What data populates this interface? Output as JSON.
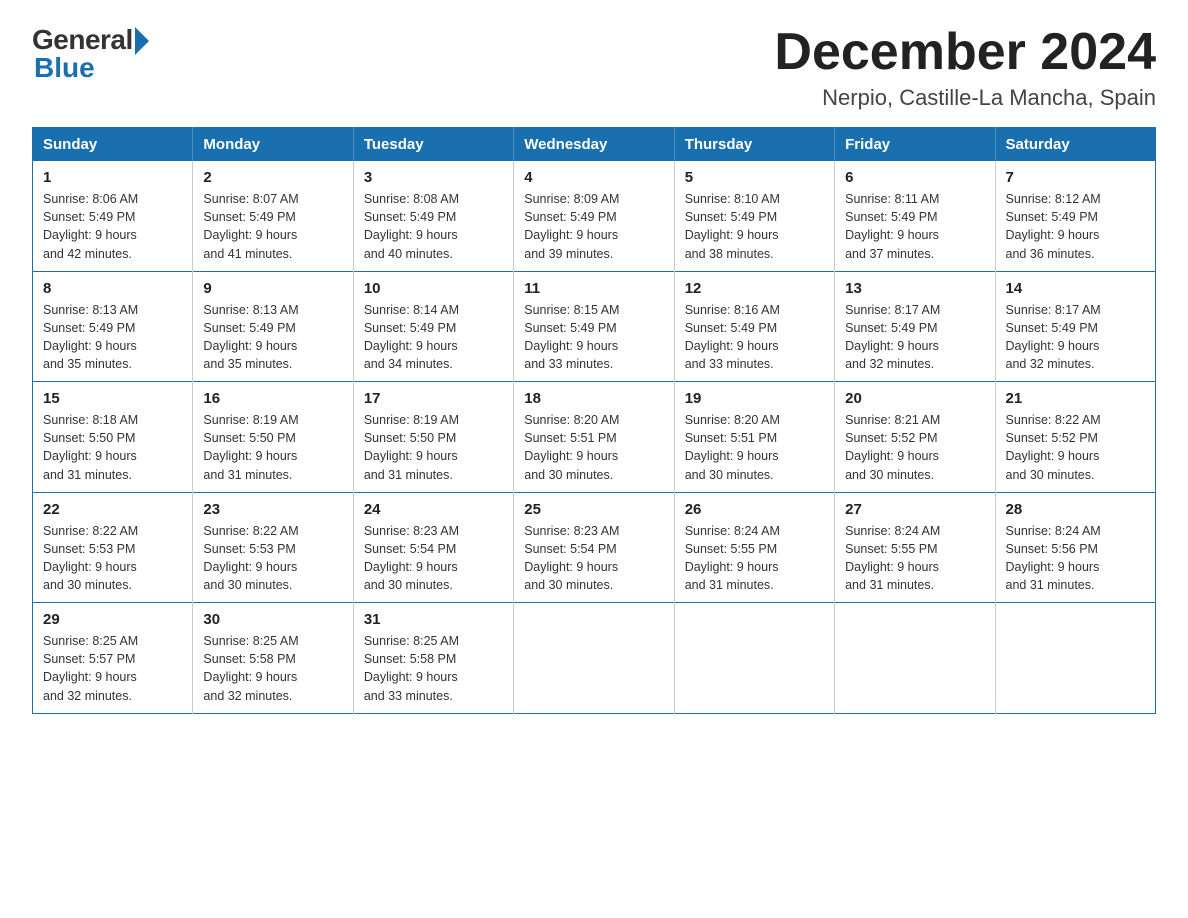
{
  "logo": {
    "general": "General",
    "blue": "Blue"
  },
  "title": "December 2024",
  "location": "Nerpio, Castille-La Mancha, Spain",
  "days_of_week": [
    "Sunday",
    "Monday",
    "Tuesday",
    "Wednesday",
    "Thursday",
    "Friday",
    "Saturday"
  ],
  "weeks": [
    [
      {
        "day": "1",
        "sunrise": "8:06 AM",
        "sunset": "5:49 PM",
        "daylight": "9 hours and 42 minutes."
      },
      {
        "day": "2",
        "sunrise": "8:07 AM",
        "sunset": "5:49 PM",
        "daylight": "9 hours and 41 minutes."
      },
      {
        "day": "3",
        "sunrise": "8:08 AM",
        "sunset": "5:49 PM",
        "daylight": "9 hours and 40 minutes."
      },
      {
        "day": "4",
        "sunrise": "8:09 AM",
        "sunset": "5:49 PM",
        "daylight": "9 hours and 39 minutes."
      },
      {
        "day": "5",
        "sunrise": "8:10 AM",
        "sunset": "5:49 PM",
        "daylight": "9 hours and 38 minutes."
      },
      {
        "day": "6",
        "sunrise": "8:11 AM",
        "sunset": "5:49 PM",
        "daylight": "9 hours and 37 minutes."
      },
      {
        "day": "7",
        "sunrise": "8:12 AM",
        "sunset": "5:49 PM",
        "daylight": "9 hours and 36 minutes."
      }
    ],
    [
      {
        "day": "8",
        "sunrise": "8:13 AM",
        "sunset": "5:49 PM",
        "daylight": "9 hours and 35 minutes."
      },
      {
        "day": "9",
        "sunrise": "8:13 AM",
        "sunset": "5:49 PM",
        "daylight": "9 hours and 35 minutes."
      },
      {
        "day": "10",
        "sunrise": "8:14 AM",
        "sunset": "5:49 PM",
        "daylight": "9 hours and 34 minutes."
      },
      {
        "day": "11",
        "sunrise": "8:15 AM",
        "sunset": "5:49 PM",
        "daylight": "9 hours and 33 minutes."
      },
      {
        "day": "12",
        "sunrise": "8:16 AM",
        "sunset": "5:49 PM",
        "daylight": "9 hours and 33 minutes."
      },
      {
        "day": "13",
        "sunrise": "8:17 AM",
        "sunset": "5:49 PM",
        "daylight": "9 hours and 32 minutes."
      },
      {
        "day": "14",
        "sunrise": "8:17 AM",
        "sunset": "5:49 PM",
        "daylight": "9 hours and 32 minutes."
      }
    ],
    [
      {
        "day": "15",
        "sunrise": "8:18 AM",
        "sunset": "5:50 PM",
        "daylight": "9 hours and 31 minutes."
      },
      {
        "day": "16",
        "sunrise": "8:19 AM",
        "sunset": "5:50 PM",
        "daylight": "9 hours and 31 minutes."
      },
      {
        "day": "17",
        "sunrise": "8:19 AM",
        "sunset": "5:50 PM",
        "daylight": "9 hours and 31 minutes."
      },
      {
        "day": "18",
        "sunrise": "8:20 AM",
        "sunset": "5:51 PM",
        "daylight": "9 hours and 30 minutes."
      },
      {
        "day": "19",
        "sunrise": "8:20 AM",
        "sunset": "5:51 PM",
        "daylight": "9 hours and 30 minutes."
      },
      {
        "day": "20",
        "sunrise": "8:21 AM",
        "sunset": "5:52 PM",
        "daylight": "9 hours and 30 minutes."
      },
      {
        "day": "21",
        "sunrise": "8:22 AM",
        "sunset": "5:52 PM",
        "daylight": "9 hours and 30 minutes."
      }
    ],
    [
      {
        "day": "22",
        "sunrise": "8:22 AM",
        "sunset": "5:53 PM",
        "daylight": "9 hours and 30 minutes."
      },
      {
        "day": "23",
        "sunrise": "8:22 AM",
        "sunset": "5:53 PM",
        "daylight": "9 hours and 30 minutes."
      },
      {
        "day": "24",
        "sunrise": "8:23 AM",
        "sunset": "5:54 PM",
        "daylight": "9 hours and 30 minutes."
      },
      {
        "day": "25",
        "sunrise": "8:23 AM",
        "sunset": "5:54 PM",
        "daylight": "9 hours and 30 minutes."
      },
      {
        "day": "26",
        "sunrise": "8:24 AM",
        "sunset": "5:55 PM",
        "daylight": "9 hours and 31 minutes."
      },
      {
        "day": "27",
        "sunrise": "8:24 AM",
        "sunset": "5:55 PM",
        "daylight": "9 hours and 31 minutes."
      },
      {
        "day": "28",
        "sunrise": "8:24 AM",
        "sunset": "5:56 PM",
        "daylight": "9 hours and 31 minutes."
      }
    ],
    [
      {
        "day": "29",
        "sunrise": "8:25 AM",
        "sunset": "5:57 PM",
        "daylight": "9 hours and 32 minutes."
      },
      {
        "day": "30",
        "sunrise": "8:25 AM",
        "sunset": "5:58 PM",
        "daylight": "9 hours and 32 minutes."
      },
      {
        "day": "31",
        "sunrise": "8:25 AM",
        "sunset": "5:58 PM",
        "daylight": "9 hours and 33 minutes."
      },
      null,
      null,
      null,
      null
    ]
  ],
  "labels": {
    "sunrise_prefix": "Sunrise: ",
    "sunset_prefix": "Sunset: ",
    "daylight_prefix": "Daylight: "
  }
}
